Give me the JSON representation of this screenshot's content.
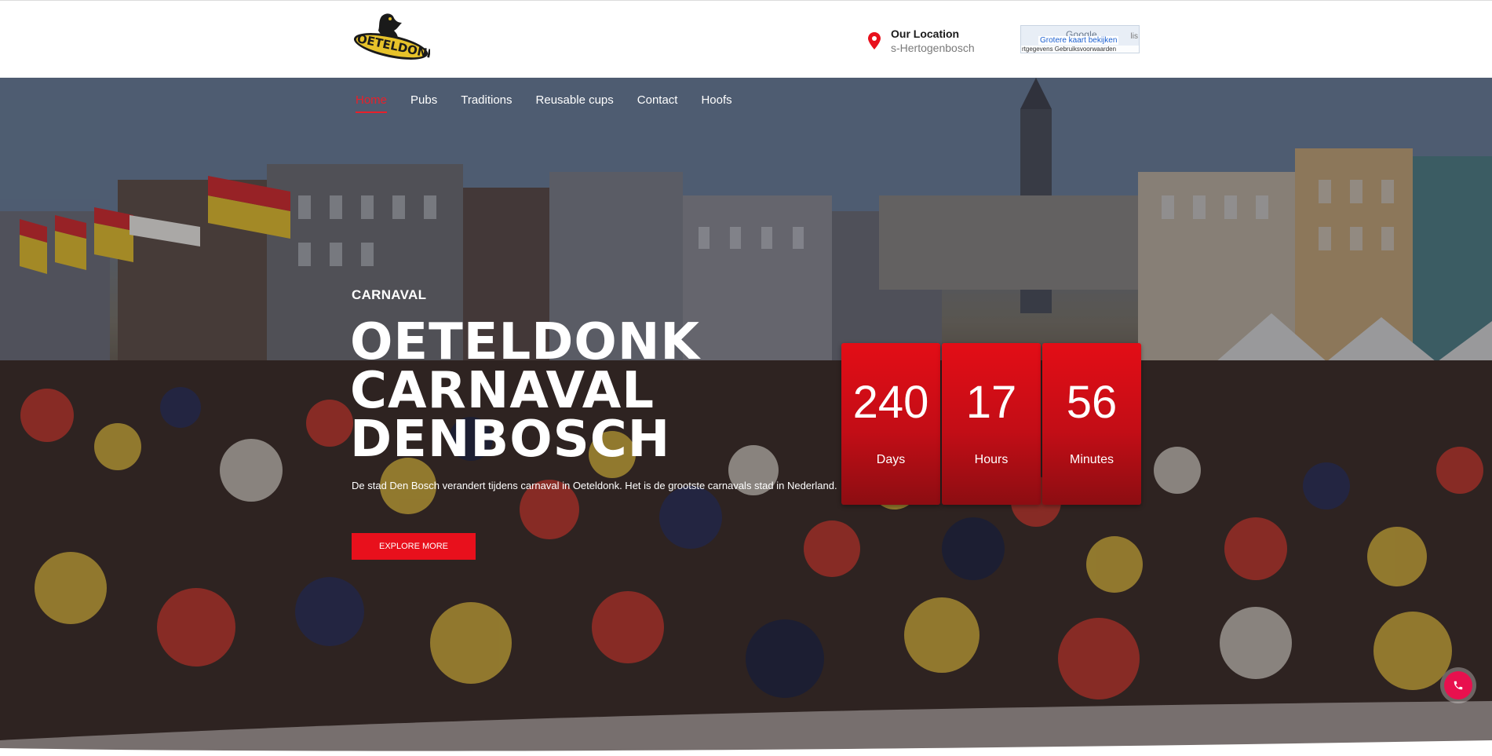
{
  "header": {
    "logo_text": "OETELDONK",
    "location_title": "Our Location",
    "location_value": "s-Hertogenbosch",
    "map": {
      "google_logo": "Google",
      "larger_map_link": "Grotere kaart bekijken",
      "terms": "rtgegevens   Gebruiksvoorwaarden",
      "right_text": "lis"
    }
  },
  "nav": {
    "items": [
      {
        "label": "Home",
        "active": true
      },
      {
        "label": "Pubs",
        "active": false
      },
      {
        "label": "Traditions",
        "active": false
      },
      {
        "label": "Reusable cups",
        "active": false
      },
      {
        "label": "Contact",
        "active": false
      },
      {
        "label": "Hoofs",
        "active": false
      }
    ]
  },
  "hero": {
    "kicker": "CARNAVAL",
    "headline_lines": [
      "OETELDONK",
      "CARNAVAL",
      "DENBOSCH"
    ],
    "description": "De stad Den Bosch verandert tijdens carnaval in Oeteldonk. Het is de grootste carnavals stad in Nederland.",
    "cta_label": "EXPLORE MORE"
  },
  "countdown": [
    {
      "value": "240",
      "label": "Days"
    },
    {
      "value": "17",
      "label": "Hours"
    },
    {
      "value": "56",
      "label": "Minutes"
    }
  ],
  "colors": {
    "accent_red": "#e8101c",
    "nav_active": "#e8202a",
    "call_button": "#e8104e"
  },
  "icons": {
    "location": "map-pin-icon",
    "call": "phone-icon"
  }
}
